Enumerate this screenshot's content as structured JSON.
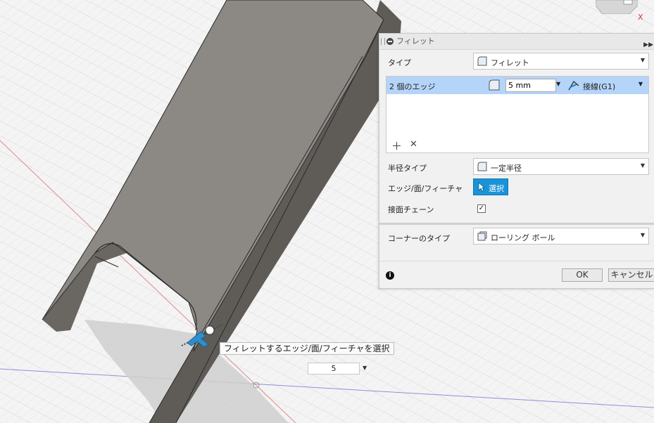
{
  "dialog": {
    "title": "フィレット",
    "type_label": "タイプ",
    "type_value": "フィレット",
    "edge_count": "2 個のエッジ",
    "radius_value": "5 mm",
    "tangent_value": "接線(G1)",
    "radius_type_label": "半径タイプ",
    "radius_type_value": "一定半径",
    "edge_face_feature_label": "エッジ/面/フィーチャ",
    "select_button": "選択",
    "tangent_chain_label": "接面チェーン",
    "tangent_chain_checked": true,
    "corner_type_label": "コーナーのタイプ",
    "corner_type_value": "ローリング ボール",
    "ok_button": "OK",
    "cancel_button": "キャンセル"
  },
  "tooltip": {
    "text": "フィレットするエッジ/面/フィーチャを選択"
  },
  "heads_up": {
    "value": "5"
  },
  "view_cube": {
    "axis_label": "X"
  },
  "colors": {
    "selection_row": "#b5d4f9",
    "select_button": "#1a93d8",
    "model_face": "#8c8985",
    "model_side": "#5d5a56"
  }
}
